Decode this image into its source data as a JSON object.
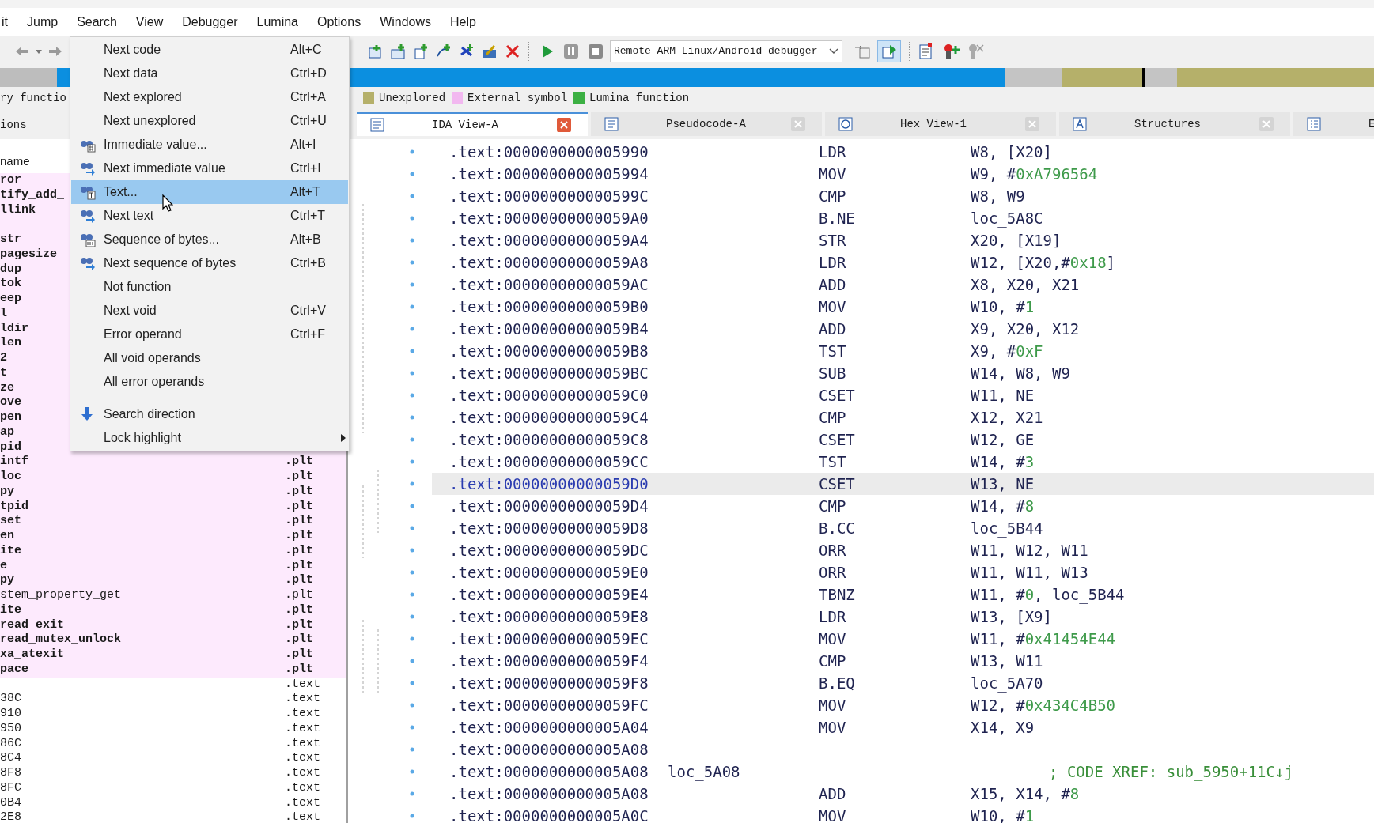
{
  "menubar": [
    "it",
    "Jump",
    "Search",
    "View",
    "Debugger",
    "Lumina",
    "Options",
    "Windows",
    "Help"
  ],
  "toolbar": {
    "debugger": "Remote ARM Linux/Android debugger"
  },
  "legend": [
    {
      "label": "ry functio"
    },
    {
      "label": "Unexplored",
      "color": "#b5b06a"
    },
    {
      "label": "External symbol",
      "color": "#f2b8f0"
    },
    {
      "label": "Lumina function",
      "color": "#3cb043"
    }
  ],
  "side_panel": {
    "tab": "ions",
    "column": "name",
    "rows": [
      {
        "name": "ror",
        "external": true,
        "bold": true
      },
      {
        "name": "tify_add_",
        "external": true,
        "bold": true
      },
      {
        "name": "llink",
        "external": true,
        "bold": true
      },
      {
        "external": true,
        "bold": true
      },
      {
        "name": "str",
        "external": true,
        "bold": true
      },
      {
        "name": "pagesize",
        "external": true,
        "bold": true
      },
      {
        "name": "dup",
        "external": true,
        "bold": true
      },
      {
        "name": "tok",
        "external": true,
        "bold": true
      },
      {
        "name": "eep",
        "external": true,
        "bold": true
      },
      {
        "name": "l",
        "external": true,
        "bold": true
      },
      {
        "name": "ldir",
        "external": true,
        "bold": true
      },
      {
        "name": "len",
        "external": true,
        "bold": true
      },
      {
        "name": "2",
        "external": true,
        "bold": true
      },
      {
        "name": "t",
        "external": true,
        "bold": true
      },
      {
        "name": "ze",
        "external": true,
        "bold": true
      },
      {
        "name": "ove",
        "external": true,
        "bold": true
      },
      {
        "name": "pen",
        "external": true,
        "bold": true
      },
      {
        "name": "ap",
        "external": true,
        "bold": true
      },
      {
        "name": "pid",
        "external": true,
        "bold": true
      },
      {
        "name": "intf",
        "segment": ".plt",
        "external": true,
        "bold": true
      },
      {
        "name": "loc",
        "segment": ".plt",
        "external": true,
        "bold": true
      },
      {
        "name": "py",
        "segment": ".plt",
        "external": true,
        "bold": true
      },
      {
        "name": "tpid",
        "segment": ".plt",
        "external": true,
        "bold": true
      },
      {
        "name": "set",
        "segment": ".plt",
        "external": true,
        "bold": true
      },
      {
        "name": "en",
        "segment": ".plt",
        "external": true,
        "bold": true
      },
      {
        "name": "ite",
        "segment": ".plt",
        "external": true,
        "bold": true
      },
      {
        "name": "e",
        "segment": ".plt",
        "external": true,
        "bold": true
      },
      {
        "name": "py",
        "segment": ".plt",
        "external": true,
        "bold": true
      },
      {
        "name": "stem_property_get",
        "segment": ".plt",
        "external": true,
        "bold": false
      },
      {
        "name": "ite",
        "segment": ".plt",
        "external": true,
        "bold": true
      },
      {
        "name": "read_exit",
        "segment": ".plt",
        "external": true,
        "bold": true
      },
      {
        "name": "read_mutex_unlock",
        "segment": ".plt",
        "external": true,
        "bold": true
      },
      {
        "name": "xa_atexit",
        "segment": ".plt",
        "external": true,
        "bold": true
      },
      {
        "name": "pace",
        "segment": ".plt",
        "external": true,
        "bold": true
      },
      {
        "segment": ".text",
        "external": false,
        "bold": false
      },
      {
        "name": "38C",
        "segment": ".text",
        "external": false,
        "bold": false
      },
      {
        "name": "910",
        "segment": ".text",
        "external": false,
        "bold": false
      },
      {
        "name": "950",
        "segment": ".text",
        "external": false,
        "bold": false
      },
      {
        "name": "86C",
        "segment": ".text",
        "external": false,
        "bold": false
      },
      {
        "name": "8C4",
        "segment": ".text",
        "external": false,
        "bold": false
      },
      {
        "name": "8F8",
        "segment": ".text",
        "external": false,
        "bold": false
      },
      {
        "name": "8FC",
        "segment": ".text",
        "external": false,
        "bold": false
      },
      {
        "name": "0B4",
        "segment": ".text",
        "external": false,
        "bold": false
      },
      {
        "name": "2E8",
        "segment": ".text",
        "external": false,
        "bold": false
      }
    ]
  },
  "tabs": [
    {
      "label": "IDA View-A",
      "kind": "listing",
      "selected": true
    },
    {
      "label": "Pseudocode-A",
      "kind": "pseudocode",
      "selected": false
    },
    {
      "label": "Hex View-1",
      "kind": "hex",
      "selected": false
    },
    {
      "label": "Structures",
      "kind": "structures",
      "selected": false
    },
    {
      "label": "E",
      "kind": "enums",
      "selected": false
    }
  ],
  "search_menu": [
    {
      "label": "Next code",
      "shortcut": "Alt+C",
      "selected": false
    },
    {
      "label": "Next data",
      "shortcut": "Ctrl+D",
      "selected": false
    },
    {
      "label": "Next explored",
      "shortcut": "Ctrl+A",
      "selected": false
    },
    {
      "label": "Next unexplored",
      "shortcut": "Ctrl+U",
      "selected": false
    },
    {
      "label": "Immediate value...",
      "shortcut": "Alt+I",
      "kind": "find-value",
      "selected": false
    },
    {
      "label": "Next immediate value",
      "shortcut": "Ctrl+I",
      "kind": "find-next",
      "selected": false
    },
    {
      "label": "Text...",
      "shortcut": "Alt+T",
      "kind": "find-text",
      "selected": true
    },
    {
      "label": "Next text",
      "shortcut": "Ctrl+T",
      "kind": "find-next",
      "selected": false
    },
    {
      "label": "Sequence of bytes...",
      "shortcut": "Alt+B",
      "kind": "find-bytes",
      "selected": false
    },
    {
      "label": "Next sequence of bytes",
      "shortcut": "Ctrl+B",
      "kind": "find-next",
      "selected": false
    },
    {
      "label": "Not function",
      "selected": false
    },
    {
      "label": "Next void",
      "shortcut": "Ctrl+V",
      "selected": false
    },
    {
      "label": "Error operand",
      "shortcut": "Ctrl+F",
      "selected": false
    },
    {
      "label": "All void operands",
      "selected": false
    },
    {
      "label": "All error operands",
      "selected": false
    },
    {
      "kind": "separator"
    },
    {
      "label": "Search direction",
      "kind": "direction",
      "selected": false
    },
    {
      "label": "Lock highlight",
      "submenu": true,
      "selected": false
    }
  ],
  "listing": [
    {
      "address": ".text:0000000000005990",
      "mnemonic": "LDR",
      "operands": [
        {
          "text": "W8, [X20]"
        }
      ],
      "selected": false
    },
    {
      "address": ".text:0000000000005994",
      "mnemonic": "MOV",
      "operands": [
        {
          "text": "W9, #"
        },
        {
          "text": "0xA796564",
          "kind": "number"
        }
      ],
      "selected": false
    },
    {
      "address": ".text:000000000000599C",
      "mnemonic": "CMP",
      "operands": [
        {
          "text": "W8, W9"
        }
      ],
      "selected": false
    },
    {
      "address": ".text:00000000000059A0",
      "mnemonic": "B.NE",
      "operands": [
        {
          "text": "loc_5A8C"
        }
      ],
      "selected": false
    },
    {
      "address": ".text:00000000000059A4",
      "mnemonic": "STR",
      "operands": [
        {
          "text": "X20, [X19]"
        }
      ],
      "selected": false
    },
    {
      "address": ".text:00000000000059A8",
      "mnemonic": "LDR",
      "operands": [
        {
          "text": "W12, [X20,#"
        },
        {
          "text": "0x18",
          "kind": "number"
        },
        {
          "text": "]"
        }
      ],
      "selected": false
    },
    {
      "address": ".text:00000000000059AC",
      "mnemonic": "ADD",
      "operands": [
        {
          "text": "X8, X20, X21"
        }
      ],
      "selected": false
    },
    {
      "address": ".text:00000000000059B0",
      "mnemonic": "MOV",
      "operands": [
        {
          "text": "W10, #"
        },
        {
          "text": "1",
          "kind": "number"
        }
      ],
      "selected": false
    },
    {
      "address": ".text:00000000000059B4",
      "mnemonic": "ADD",
      "operands": [
        {
          "text": "X9, X20, X12"
        }
      ],
      "selected": false
    },
    {
      "address": ".text:00000000000059B8",
      "mnemonic": "TST",
      "operands": [
        {
          "text": "X9, #"
        },
        {
          "text": "0xF",
          "kind": "number"
        }
      ],
      "selected": false
    },
    {
      "address": ".text:00000000000059BC",
      "mnemonic": "SUB",
      "operands": [
        {
          "text": "W14, W8, W9"
        }
      ],
      "selected": false
    },
    {
      "address": ".text:00000000000059C0",
      "mnemonic": "CSET",
      "operands": [
        {
          "text": "W11, NE"
        }
      ],
      "selected": false
    },
    {
      "address": ".text:00000000000059C4",
      "mnemonic": "CMP",
      "operands": [
        {
          "text": "X12, X21"
        }
      ],
      "selected": false
    },
    {
      "address": ".text:00000000000059C8",
      "mnemonic": "CSET",
      "operands": [
        {
          "text": "W12, GE"
        }
      ],
      "selected": false
    },
    {
      "address": ".text:00000000000059CC",
      "mnemonic": "TST",
      "operands": [
        {
          "text": "W14, #"
        },
        {
          "text": "3",
          "kind": "number"
        }
      ],
      "selected": false
    },
    {
      "address": ".text:00000000000059D0",
      "mnemonic": "CSET",
      "operands": [
        {
          "text": "W13, NE"
        }
      ],
      "selected": true
    },
    {
      "address": ".text:00000000000059D4",
      "mnemonic": "CMP",
      "operands": [
        {
          "text": "W14, #"
        },
        {
          "text": "8",
          "kind": "number"
        }
      ],
      "selected": false
    },
    {
      "address": ".text:00000000000059D8",
      "mnemonic": "B.CC",
      "operands": [
        {
          "text": "loc_5B44"
        }
      ],
      "selected": false
    },
    {
      "address": ".text:00000000000059DC",
      "mnemonic": "ORR",
      "operands": [
        {
          "text": "W11, W12, W11"
        }
      ],
      "selected": false
    },
    {
      "address": ".text:00000000000059E0",
      "mnemonic": "ORR",
      "operands": [
        {
          "text": "W11, W11, W13"
        }
      ],
      "selected": false
    },
    {
      "address": ".text:00000000000059E4",
      "mnemonic": "TBNZ",
      "operands": [
        {
          "text": "W11, #"
        },
        {
          "text": "0",
          "kind": "number"
        },
        {
          "text": ", loc_5B44"
        }
      ],
      "selected": false
    },
    {
      "address": ".text:00000000000059E8",
      "mnemonic": "LDR",
      "operands": [
        {
          "text": "W13, [X9]"
        }
      ],
      "selected": false
    },
    {
      "address": ".text:00000000000059EC",
      "mnemonic": "MOV",
      "operands": [
        {
          "text": "W11, #"
        },
        {
          "text": "0x41454E44",
          "kind": "number"
        }
      ],
      "selected": false
    },
    {
      "address": ".text:00000000000059F4",
      "mnemonic": "CMP",
      "operands": [
        {
          "text": "W13, W11"
        }
      ],
      "selected": false
    },
    {
      "address": ".text:00000000000059F8",
      "mnemonic": "B.EQ",
      "operands": [
        {
          "text": "loc_5A70"
        }
      ],
      "selected": false
    },
    {
      "address": ".text:00000000000059FC",
      "mnemonic": "MOV",
      "operands": [
        {
          "text": "W12, #"
        },
        {
          "text": "0x434C4B50",
          "kind": "number"
        }
      ],
      "selected": false
    },
    {
      "address": ".text:0000000000005A04",
      "mnemonic": "MOV",
      "operands": [
        {
          "text": "X14, X9"
        }
      ],
      "selected": false
    },
    {
      "address": ".text:0000000000005A08",
      "selected": false
    },
    {
      "address": ".text:0000000000005A08",
      "label": "loc_5A08",
      "comment": "; CODE XREF: sub_5950+11C↓j",
      "selected": false
    },
    {
      "address": ".text:0000000000005A08",
      "mnemonic": "ADD",
      "operands": [
        {
          "text": "X15, X14, #"
        },
        {
          "text": "8",
          "kind": "number"
        }
      ],
      "selected": false
    },
    {
      "address": ".text:0000000000005A0C",
      "mnemonic": "MOV",
      "operands": [
        {
          "text": "W10, #"
        },
        {
          "text": "1",
          "kind": "number"
        }
      ],
      "selected": false
    }
  ]
}
